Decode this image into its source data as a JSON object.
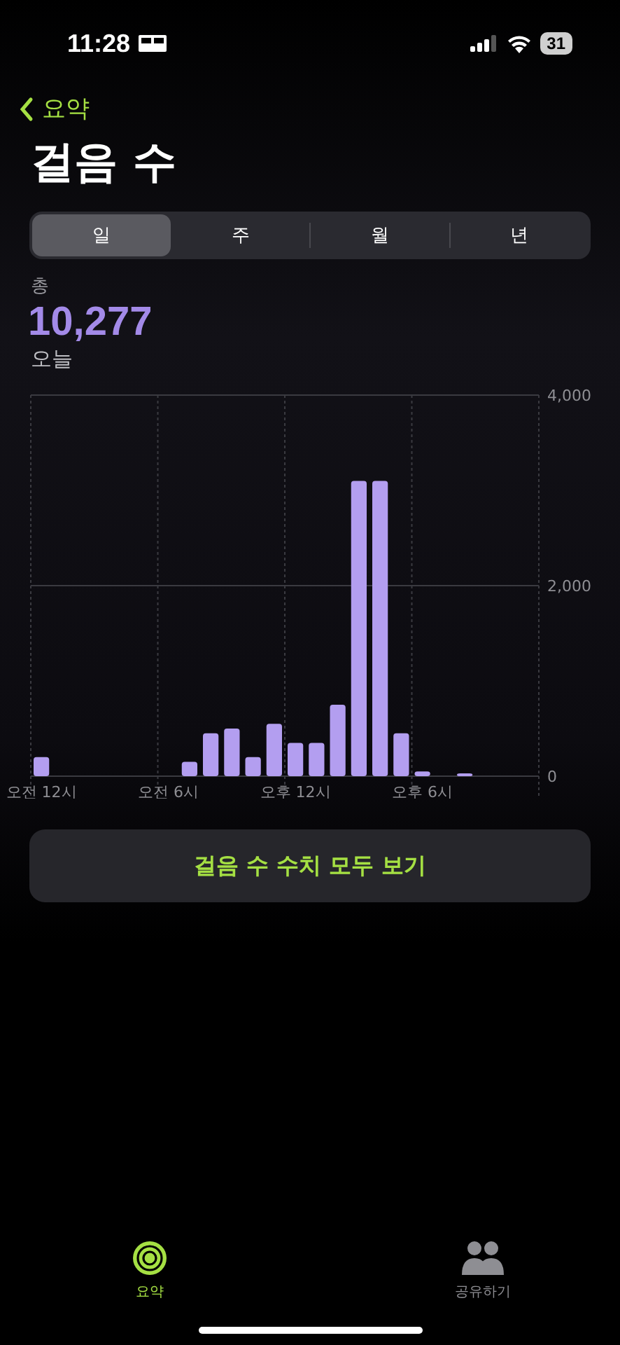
{
  "status_bar": {
    "time": "11:28",
    "battery": "31"
  },
  "nav": {
    "back": "요약"
  },
  "title": "걸음 수",
  "segments": [
    {
      "label": "일",
      "selected": true
    },
    {
      "label": "주",
      "selected": false
    },
    {
      "label": "월",
      "selected": false
    },
    {
      "label": "년",
      "selected": false
    }
  ],
  "summary": {
    "label": "총",
    "value": "10,277",
    "period": "오늘"
  },
  "chart_data": {
    "type": "bar",
    "categories": [
      "오전 12시",
      null,
      null,
      null,
      null,
      null,
      "오전 6시",
      null,
      null,
      null,
      null,
      null,
      "오후 12시",
      null,
      null,
      null,
      null,
      null,
      "오후 6시",
      null,
      null,
      null,
      null,
      null
    ],
    "values": [
      200,
      0,
      0,
      0,
      0,
      0,
      0,
      150,
      450,
      500,
      200,
      550,
      350,
      350,
      750,
      3100,
      3100,
      450,
      50,
      0,
      10,
      0,
      0,
      0
    ],
    "ylim": [
      0,
      4000
    ],
    "ref_lines": [
      {
        "axis": "y",
        "value": 2000
      }
    ],
    "yticks": [
      {
        "value": 0,
        "label": "0"
      },
      {
        "value": 2000,
        "label": "2,000"
      },
      {
        "value": 4000,
        "label": "4,000"
      }
    ]
  },
  "show_all_button": "걸음 수 수치 모두 보기",
  "tab_bar": [
    {
      "label": "요약",
      "kind": "summary",
      "selected": true
    },
    {
      "label": "공유하기",
      "kind": "sharing",
      "selected": false
    }
  ]
}
